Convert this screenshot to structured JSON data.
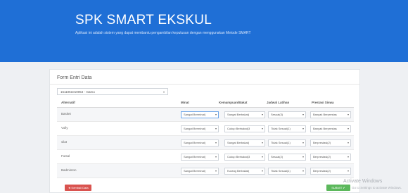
{
  "header": {
    "title": "SPK SMART EKSKUL",
    "subtitle": "Aplikasi ini adalah sistem yang dapat membantu pengambilan keputusan dengan menggunakan Metode SMART"
  },
  "form": {
    "title": "Form Entri Data",
    "nim_value": "1511051010054 - mamu",
    "columns": [
      "Alternatif",
      "Minat",
      "Kemampuan/Bakat",
      "Jadwal Latihan",
      "Prestasi Siswa"
    ],
    "rows": [
      {
        "alternatif": "Basket",
        "minat": "Sangat Berminat(",
        "kemampuan": "Sangat Berbakat(",
        "jadwal": "Sesuai(3)",
        "prestasi": "Banyak Berprestas"
      },
      {
        "alternatif": "Volly",
        "minat": "Sangat Berminat(",
        "kemampuan": "Cukup Berbakat(3",
        "jadwal": "Tidak Sesuai(1)",
        "prestasi": "Banyak Berprestas"
      },
      {
        "alternatif": "silat",
        "minat": "Sangat Berminat(",
        "kemampuan": "Sangat Berbakat(",
        "jadwal": "Tidak Sesuai(1)",
        "prestasi": "Berprestasi(2)"
      },
      {
        "alternatif": "Futsal",
        "minat": "Sangat Berminat(",
        "kemampuan": "Cukup Berbakat(3",
        "jadwal": "Sesuai(2)",
        "prestasi": "Berprestasi(2)"
      },
      {
        "alternatif": "Badminton",
        "minat": "Sangat Berminat(",
        "kemampuan": "Kurang Berbakat(",
        "jadwal": "Tidak Sesuai(1)",
        "prestasi": "Berprestasi(2)"
      }
    ]
  },
  "buttons": {
    "back": "Kembali Data",
    "submit": "SUBMIT"
  },
  "watermark": {
    "line1": "Activate Windows",
    "line2": "Go to Settings to activate Windows."
  },
  "icons": {
    "select_caret": "▾",
    "back_icon": "◄",
    "submit_icon": "✔"
  }
}
